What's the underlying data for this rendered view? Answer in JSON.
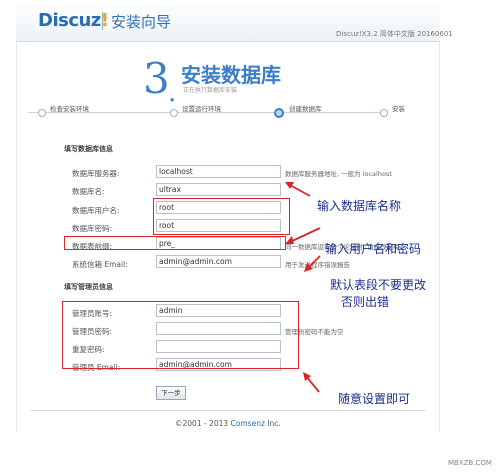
{
  "header": {
    "logo_text": "Discuz",
    "logo_bang": "!",
    "wizard_title": "安装向导",
    "version": "Discuz!X3.2 简体中文版 20160601"
  },
  "step": {
    "number": "3",
    "dot": ".",
    "title": "安装数据库",
    "subtitle": "正在执行数据库安装"
  },
  "progress": {
    "steps": [
      "检查安装环境",
      "设置运行环境",
      "创建数据库",
      "安装"
    ],
    "active_index": 2
  },
  "db_section": {
    "title": "填写数据库信息",
    "fields": [
      {
        "label": "数据库服务器:",
        "value": "localhost",
        "hint": "数据库服务器地址, 一般为 localhost"
      },
      {
        "label": "数据库名:",
        "value": "ultrax",
        "hint": ""
      },
      {
        "label": "数据库用户名:",
        "value": "root",
        "hint": ""
      },
      {
        "label": "数据库密码:",
        "value": "root",
        "hint": ""
      },
      {
        "label": "数据表前缀:",
        "value": "pre_",
        "hint": "同一数据库运行多个论坛时, 请修改前缀"
      },
      {
        "label": "系统信箱 Email:",
        "value": "admin@admin.com",
        "hint": "用于发送程序错误报告"
      }
    ]
  },
  "admin_section": {
    "title": "填写管理员信息",
    "fields": [
      {
        "label": "管理员账号:",
        "value": "admin",
        "hint": ""
      },
      {
        "label": "管理员密码:",
        "value": "",
        "hint": "管理员密码不能为空"
      },
      {
        "label": "重复密码:",
        "value": "",
        "hint": ""
      },
      {
        "label": "管理员 Email:",
        "value": "admin@admin.com",
        "hint": ""
      }
    ]
  },
  "annotations": {
    "db_name": "输入数据库名称",
    "user_pass": "输入用户名和密码",
    "prefix_line1": "默认表段不要更改",
    "prefix_line2": "否则出错",
    "admin": "随意设置即可",
    "color": "#1b2f8c",
    "box_color": "#d9262a"
  },
  "actions": {
    "next_label": "下一步"
  },
  "footer": {
    "copyright": "©2001 - 2013 ",
    "brand": "Comsenz",
    "suffix": " Inc."
  },
  "watermark": "MBXZB.COM"
}
